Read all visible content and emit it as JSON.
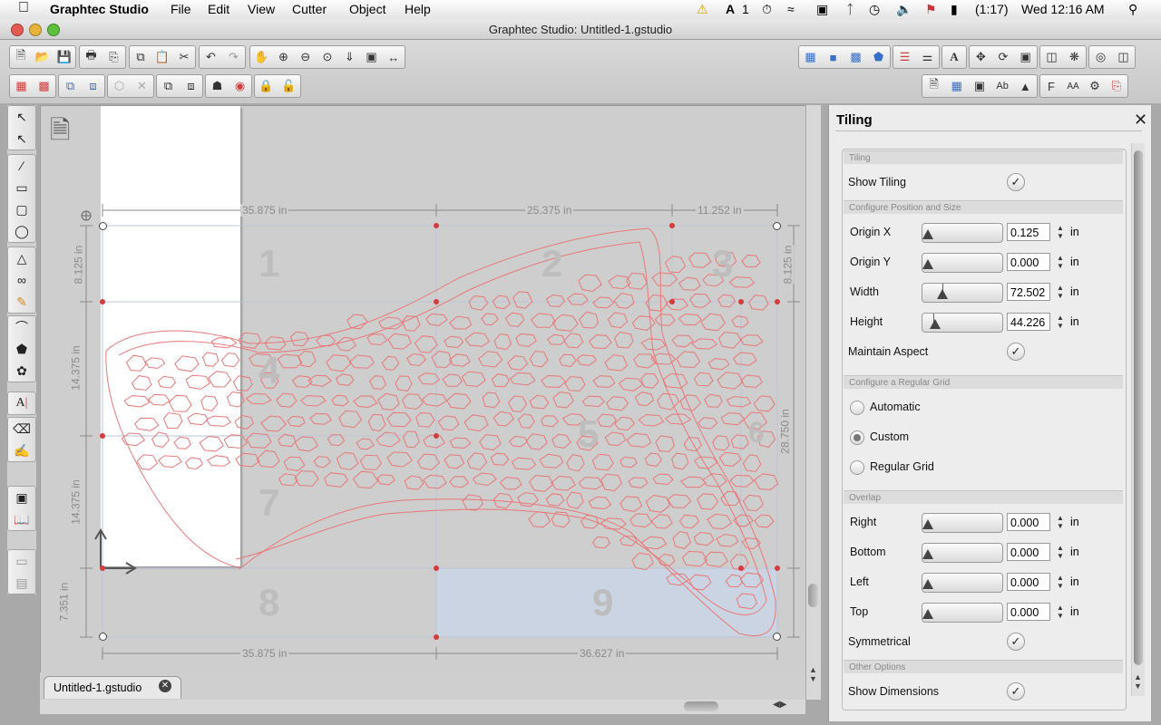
{
  "menubar": {
    "app_name": "Graphtec Studio",
    "items": [
      "File",
      "Edit",
      "View",
      "Cutter",
      "Object",
      "Help"
    ],
    "status": {
      "adobe_count": "1",
      "battery": "(1:17)",
      "clock": "Wed 12:16 AM"
    }
  },
  "window": {
    "title": "Graphtec Studio: Untitled-1.gstudio"
  },
  "document_tab": {
    "label": "Untitled-1.gstudio"
  },
  "canvas": {
    "tile_numbers": [
      "1",
      "2",
      "3",
      "4",
      "5",
      "6",
      "7",
      "8",
      "9"
    ],
    "top_dims": [
      "35.875 in",
      "25.375 in",
      "11.252 in"
    ],
    "bottom_dims": [
      "35.875 in",
      "36.627 in"
    ],
    "left_dims": [
      "8.125 in",
      "14.375 in",
      "14.375 in",
      "7.351 in"
    ],
    "right_dims": [
      "8.125 in",
      "28.750 in"
    ]
  },
  "panel": {
    "title": "Tiling",
    "sections": {
      "tiling": "Tiling",
      "position": "Configure Position and Size",
      "grid": "Configure a Regular Grid",
      "overlap": "Overlap",
      "other": "Other Options"
    },
    "show_tiling": {
      "label": "Show Tiling",
      "checked": true
    },
    "fields": [
      {
        "label": "Origin X",
        "value": "0.125",
        "unit": "in"
      },
      {
        "label": "Origin Y",
        "value": "0.000",
        "unit": "in"
      },
      {
        "label": "Width",
        "value": "72.502",
        "unit": "in"
      },
      {
        "label": "Height",
        "value": "44.226",
        "unit": "in"
      }
    ],
    "maintain_aspect": {
      "label": "Maintain Aspect",
      "checked": true
    },
    "grid_options": [
      {
        "label": "Automatic",
        "selected": false
      },
      {
        "label": "Custom",
        "selected": true
      },
      {
        "label": "Regular Grid",
        "selected": false
      }
    ],
    "overlap_fields": [
      {
        "label": "Right",
        "value": "0.000",
        "unit": "in"
      },
      {
        "label": "Bottom",
        "value": "0.000",
        "unit": "in"
      },
      {
        "label": "Left",
        "value": "0.000",
        "unit": "in"
      },
      {
        "label": "Top",
        "value": "0.000",
        "unit": "in"
      }
    ],
    "symmetrical": {
      "label": "Symmetrical",
      "checked": true
    },
    "show_dimensions": {
      "label": "Show Dimensions",
      "checked": true
    }
  },
  "colors": {
    "cut_lines": "#e87878",
    "accent_dot": "#d43c3c",
    "tile_highlight": "#c9d6e8"
  }
}
